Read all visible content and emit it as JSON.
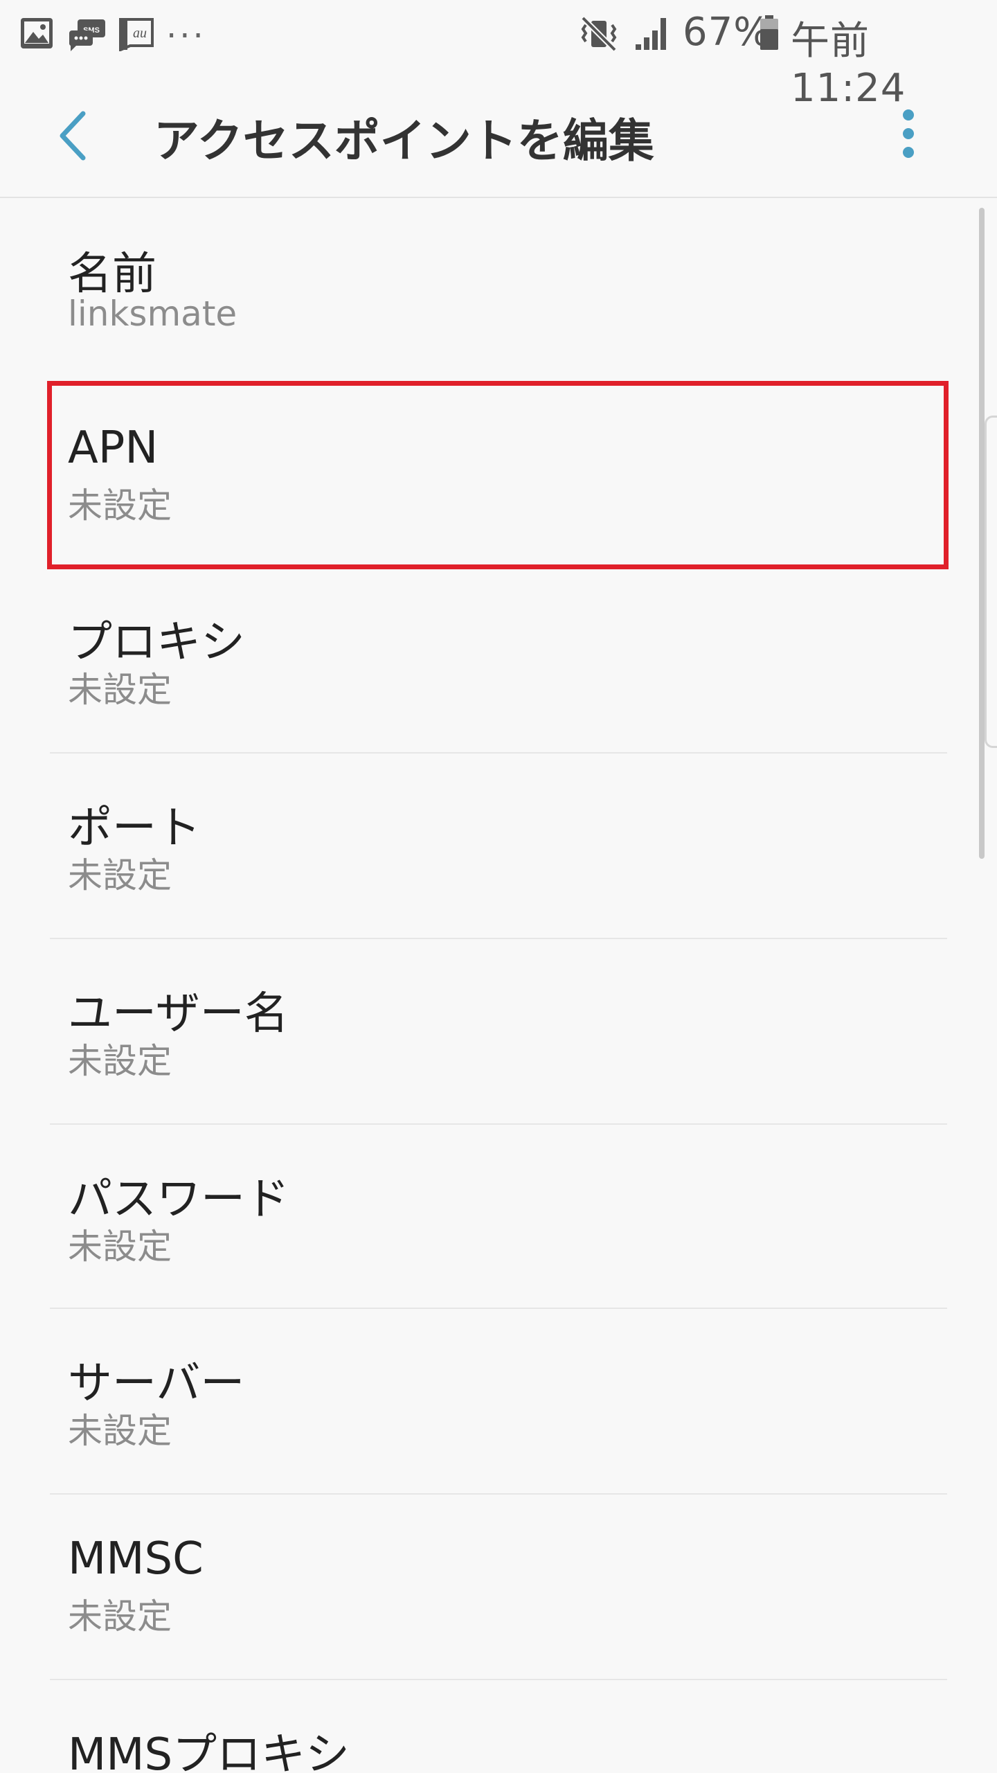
{
  "status_bar": {
    "notification_icons": [
      "gallery-icon",
      "sms-icon",
      "au-icon"
    ],
    "overflow_dots": "...",
    "battery_percent": "67%",
    "time": "午前 11:24"
  },
  "app_bar": {
    "title": "アクセスポイントを編集"
  },
  "settings": [
    {
      "label": "名前",
      "value": "linksmate"
    },
    {
      "label": "APN",
      "value": "未設定"
    },
    {
      "label": "プロキシ",
      "value": "未設定"
    },
    {
      "label": "ポート",
      "value": "未設定"
    },
    {
      "label": "ユーザー名",
      "value": "未設定"
    },
    {
      "label": "パスワード",
      "value": "未設定"
    },
    {
      "label": "サーバー",
      "value": "未設定"
    },
    {
      "label": "MMSC",
      "value": "未設定"
    },
    {
      "label": "MMSプロキシ",
      "value": ""
    }
  ],
  "colors": {
    "accent": "#4a9fc4",
    "highlight": "#e0202a",
    "background": "#f8f8f8"
  }
}
